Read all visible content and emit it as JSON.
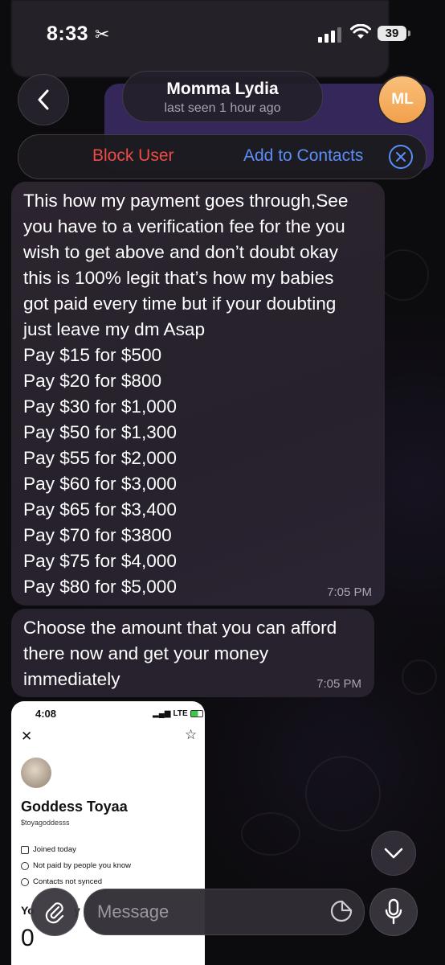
{
  "status": {
    "time": "8:33",
    "battery": "39"
  },
  "header": {
    "name": "Momma Lydia",
    "last_seen": "last seen 1 hour ago",
    "avatar_initials": "ML"
  },
  "action_bar": {
    "block_label": "Block User",
    "add_label": "Add to Contacts"
  },
  "messages": [
    {
      "lines": [
        "This how my payment goes through,See",
        "you have to a verification fee for the you",
        "wish to get above and don’t doubt okay",
        "this is 100% legit that’s how my babies",
        "got paid every time but if your doubting",
        "just leave my dm Asap",
        "Pay $15 for $500",
        "Pay $20 for $800",
        "Pay $30 for $1,000",
        "Pay $50 for $1,300",
        "Pay $55 for $2,000",
        "Pay $60 for $3,000",
        "Pay $65 for $3,400",
        "Pay $70 for $3800",
        "Pay $75 for $4,000",
        "Pay $80 for $5,000"
      ],
      "time": "7:05 PM"
    },
    {
      "lines": [
        "Choose the amount that you can afford",
        "there now and get your money",
        "immediately"
      ],
      "time": "7:05 PM"
    }
  ],
  "screenshot_card": {
    "time": "4:08",
    "network": "LTE",
    "name": "Goddess Toyaa",
    "handle": "$toyagoddesss",
    "info": [
      "Joined today",
      "Not paid by people you know",
      "Contacts not synced"
    ],
    "bottom_label": "Yo",
    "bottom_label_2": "y",
    "amount": "0"
  },
  "input": {
    "placeholder": "Message"
  },
  "colors": {
    "block": "#ef4a44",
    "accent": "#5b8ef7",
    "bubble": "#27222d",
    "avatar": "#f2a04c"
  }
}
